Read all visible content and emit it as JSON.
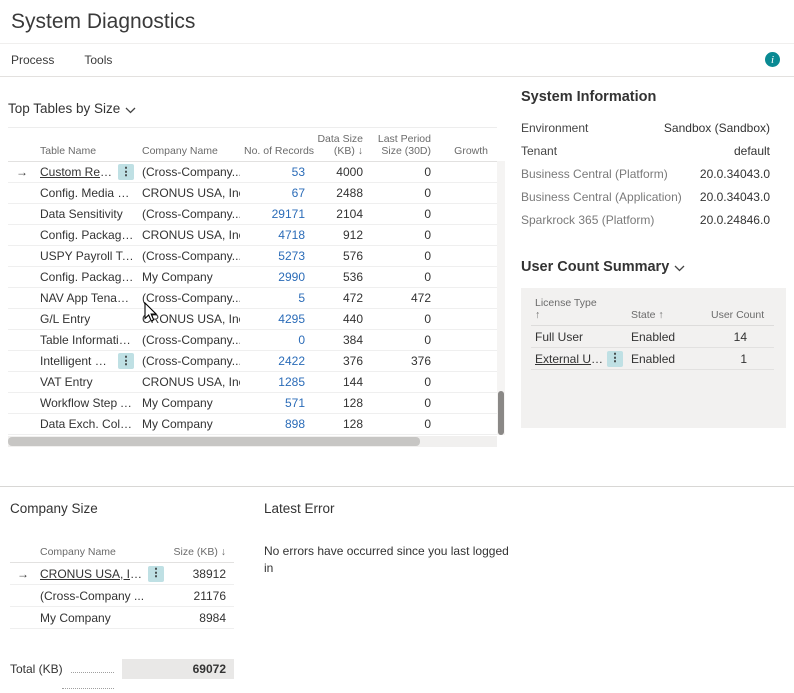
{
  "colors": {
    "accent_teal": "#0a8a93",
    "link_blue": "#2b6cb8",
    "kebab_bg": "#bfe0e4",
    "total_box_bg": "#e9e8e7"
  },
  "page": {
    "title": "System Diagnostics"
  },
  "menu": {
    "items": [
      {
        "label": "Process"
      },
      {
        "label": "Tools"
      }
    ]
  },
  "top_tables": {
    "title": "Top Tables by Size",
    "columns": {
      "table_name": "Table Name",
      "company": "Company Name",
      "records": "No. of Records",
      "data_size_l1": "Data Size",
      "data_size_l2": "(KB) ↓",
      "last_period_l1": "Last Period",
      "last_period_l2": "Size (30D)",
      "growth": "Growth"
    },
    "rows": [
      {
        "name": "Custom Report ...",
        "company": "(Cross-Company...",
        "records": "53",
        "size": "4000",
        "last": "0",
        "selected": true,
        "kebab": true,
        "underline": true
      },
      {
        "name": "Config. Media B...",
        "company": "CRONUS USA, Inc.",
        "records": "67",
        "size": "2488",
        "last": "0"
      },
      {
        "name": "Data Sensitivity",
        "company": "(Cross-Company...",
        "records": "29171",
        "size": "2104",
        "last": "0"
      },
      {
        "name": "Config. Package ...",
        "company": "CRONUS USA, Inc.",
        "records": "4718",
        "size": "912",
        "last": "0"
      },
      {
        "name": "USPY Payroll Tax...",
        "company": "(Cross-Company...",
        "records": "5273",
        "size": "576",
        "last": "0"
      },
      {
        "name": "Config. Package ...",
        "company": "My Company",
        "records": "2990",
        "size": "536",
        "last": "0"
      },
      {
        "name": "NAV App Tenant...",
        "company": "(Cross-Company...",
        "records": "5",
        "size": "472",
        "last": "472"
      },
      {
        "name": "G/L Entry",
        "company": "CRONUS USA, Inc.",
        "records": "4295",
        "size": "440",
        "last": "0"
      },
      {
        "name": "Table Informatio...",
        "company": "(Cross-Company...",
        "records": "0",
        "size": "384",
        "last": "0"
      },
      {
        "name": "Intelligent Cloud...",
        "company": "(Cross-Company...",
        "records": "2422",
        "size": "376",
        "last": "376",
        "kebab": true
      },
      {
        "name": "VAT Entry",
        "company": "CRONUS USA, Inc.",
        "records": "1285",
        "size": "144",
        "last": "0"
      },
      {
        "name": "Workflow Step A...",
        "company": "My Company",
        "records": "571",
        "size": "128",
        "last": "0"
      },
      {
        "name": "Data Exch. Colu...",
        "company": "My Company",
        "records": "898",
        "size": "128",
        "last": "0"
      }
    ]
  },
  "system_info": {
    "title": "System Information",
    "rows": [
      {
        "label": "Environment",
        "value": "Sandbox (Sandbox)",
        "muted": false
      },
      {
        "label": "Tenant",
        "value": "default",
        "muted": false
      },
      {
        "label": "Business Central (Platform)",
        "value": "20.0.34043.0",
        "muted": true
      },
      {
        "label": "Business Central (Application)",
        "value": "20.0.34043.0",
        "muted": true
      },
      {
        "label": "Sparkrock 365 (Platform)",
        "value": "20.0.24846.0",
        "muted": true
      }
    ]
  },
  "user_count": {
    "title": "User Count Summary",
    "columns": {
      "license_l1": "License Type",
      "license_l2": "↑",
      "state": "State ↑",
      "count": "User Count"
    },
    "rows": [
      {
        "license": "Full User",
        "state": "Enabled",
        "count": "14"
      },
      {
        "license": "External User",
        "state": "Enabled",
        "count": "1",
        "kebab": true,
        "underline": true
      }
    ]
  },
  "company_size": {
    "title": "Company Size",
    "columns": {
      "name": "Company Name",
      "size": "Size (KB) ↓"
    },
    "rows": [
      {
        "name": "CRONUS USA, Inc.",
        "size": "38912",
        "selected": true,
        "kebab": true,
        "underline": true
      },
      {
        "name": "(Cross-Company ...",
        "size": "21176"
      },
      {
        "name": "My Company",
        "size": "8984"
      }
    ],
    "total_label": "Total (KB)",
    "total_value": "69072"
  },
  "latest_error": {
    "title": "Latest Error",
    "message": "No errors have occurred since you last logged in"
  }
}
